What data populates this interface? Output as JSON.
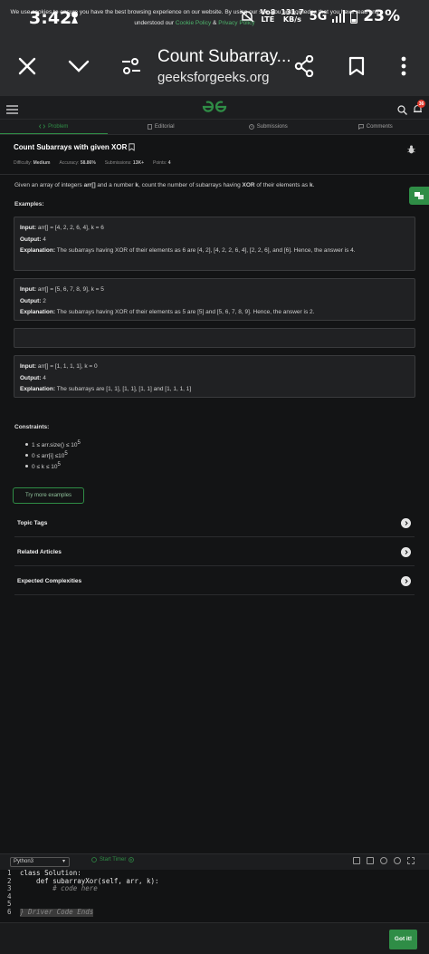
{
  "status_bar": {
    "time": "3:42",
    "volte": "Vo8",
    "lte": "LTE",
    "speed_value": "131.7",
    "speed_unit": "KB/s",
    "network": "5G",
    "battery": "23%"
  },
  "browser": {
    "title": "Count Subarray...",
    "host": "geeksforgeeks.org"
  },
  "site": {
    "notification_count": "36"
  },
  "tabs": [
    {
      "label": "Problem",
      "icon": "code-icon"
    },
    {
      "label": "Editorial",
      "icon": "document-icon"
    },
    {
      "label": "Submissions",
      "icon": "clock-icon"
    },
    {
      "label": "Comments",
      "icon": "chat-icon"
    }
  ],
  "problem": {
    "title": "Count Subarrays with given XOR",
    "difficulty_label": "Difficulty:",
    "difficulty": "Medium",
    "accuracy_label": "Accuracy:",
    "accuracy": "58.86%",
    "submissions_label": "Submissions:",
    "submissions": "13K+",
    "points_label": "Points:",
    "points": "4",
    "statement_parts": [
      "Given an array of integers ",
      "arr[]",
      " and a number ",
      "k",
      ", count the number of subarrays having ",
      "XOR",
      " of their elements as ",
      "k",
      "."
    ],
    "examples_label": "Examples:",
    "examples": [
      {
        "input_label": "Input:",
        "input": "arr[] = [4, 2, 2, 6, 4], k = 6",
        "output_label": "Output:",
        "output": "4",
        "explanation_label": "Explanation:",
        "explanation": "The subarrays having XOR of their elements as 6 are [4, 2], [4, 2, 2, 6, 4], [2, 2, 6], and [6]. Hence, the answer is 4."
      },
      {
        "input_label": "Input:",
        "input": "arr[] = [5, 6, 7, 8, 9], k = 5",
        "output_label": "Output:",
        "output": "2",
        "explanation_label": "Explanation:",
        "explanation": "The subarrays having XOR of their elements as 5 are [5] and [5, 6, 7, 8, 9]. Hence, the answer is 2."
      },
      {
        "input_label": "Input:",
        "input": "arr[] = [1, 1, 1, 1], k = 0",
        "output_label": "Output:",
        "output": "4",
        "explanation_label": "Explanation:",
        "explanation": "The subarrays are [1, 1], [1, 1], [1, 1] and [1, 1, 1, 1]"
      }
    ],
    "constraints_label": "Constraints:",
    "constraints": [
      {
        "text": "1 ≤ arr.size() ≤ 10",
        "sup": "5"
      },
      {
        "text": "0 ≤ arr[i] ≤10",
        "sup": "5"
      },
      {
        "text": "0 ≤ k ≤ 10",
        "sup": "5"
      }
    ],
    "try_more": "Try more examples",
    "sections": [
      "Topic Tags",
      "Related Articles",
      "Expected Complexities"
    ]
  },
  "editor": {
    "language": "Python3",
    "start_timer": "Start Timer",
    "code_lines": [
      {
        "n": "1",
        "text": "class Solution:"
      },
      {
        "n": "2",
        "text": "    def subarrayXor(self, arr, k):"
      },
      {
        "n": "3",
        "text": "        # code here"
      },
      {
        "n": "4",
        "text": ""
      },
      {
        "n": "5",
        "text": ""
      },
      {
        "n": "6",
        "text": "} Driver Code Ends"
      }
    ]
  },
  "cookie": {
    "text_1": "We use cookies to ensure you have the best browsing experience on our website. By using our site, you acknowledge that you have read and",
    "text_2": "understood our ",
    "cookie_policy": "Cookie Policy",
    "amp": " & ",
    "privacy_policy": "Privacy Policy",
    "button": "Got it!"
  },
  "colors": {
    "accent_green": "#2f8d46",
    "background": "#131415",
    "notification_red": "#e23b2e"
  }
}
